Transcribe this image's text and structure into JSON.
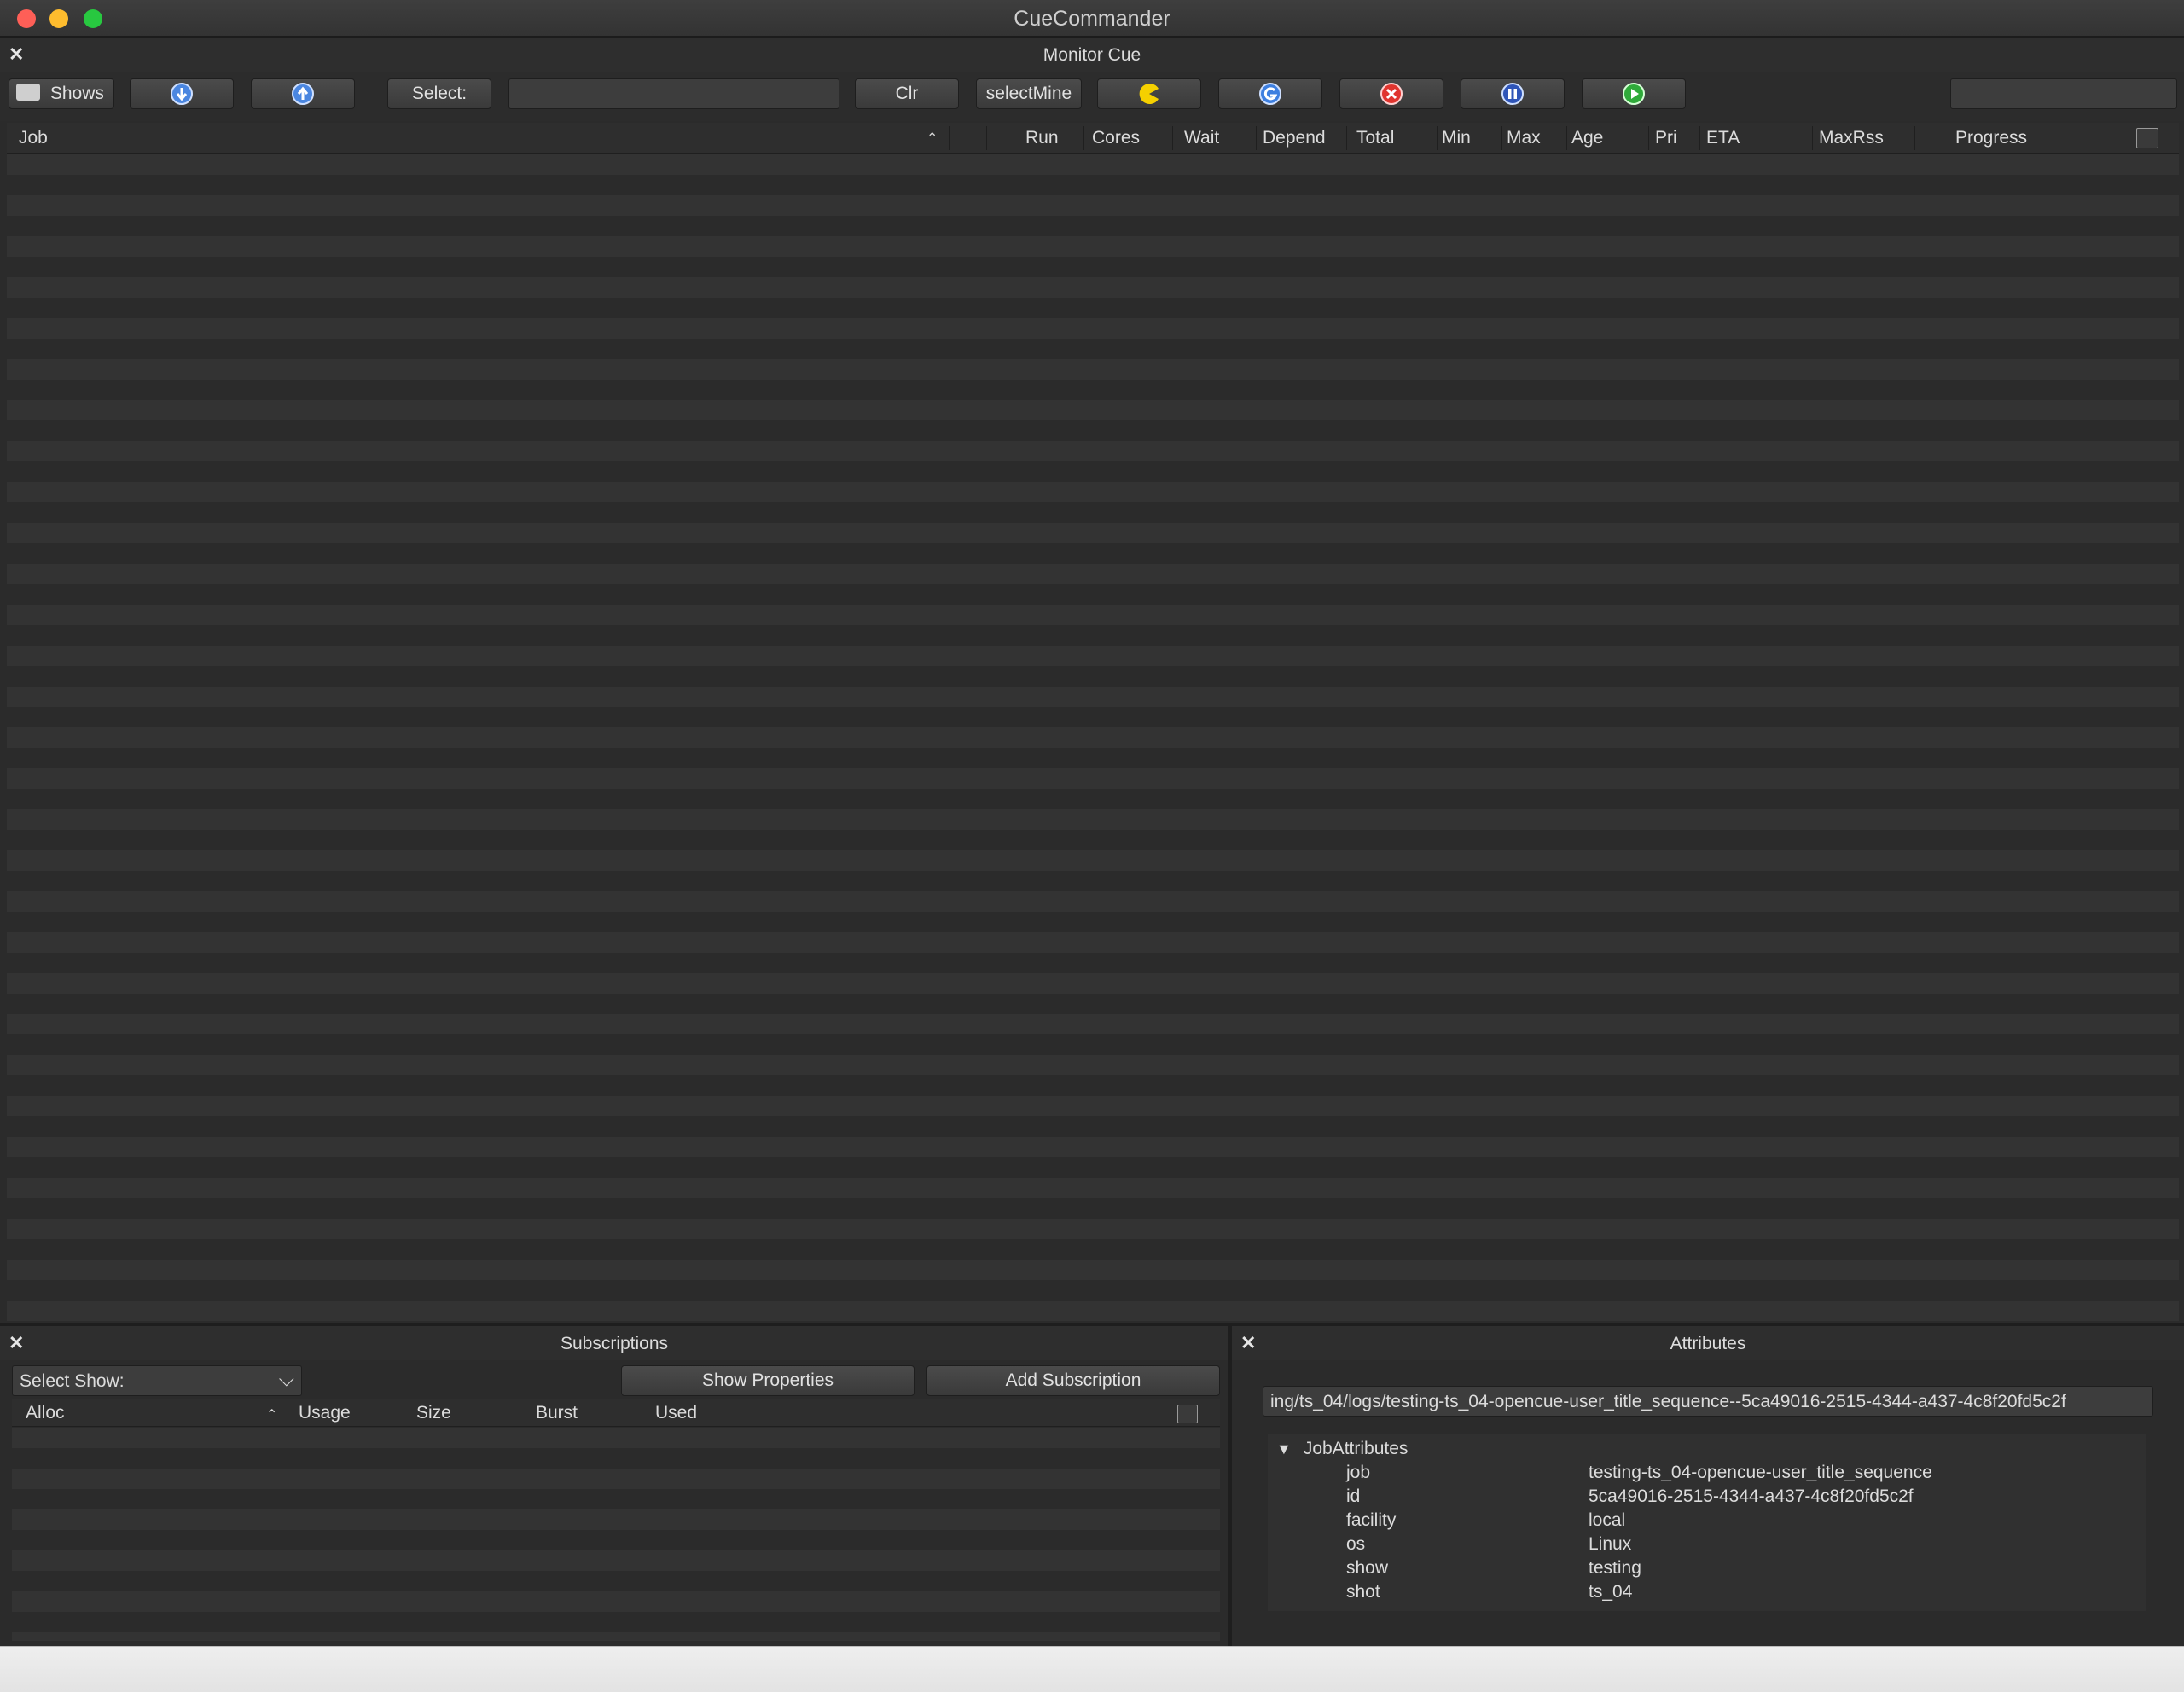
{
  "window": {
    "title": "CueCommander"
  },
  "monitor_cue": {
    "title": "Monitor Cue",
    "toolbar": {
      "shows_label": "Shows",
      "select_label": "Select:",
      "clr_label": "Clr",
      "selectmine_label": "selectMine"
    },
    "columns": [
      "Job",
      "Run",
      "Cores",
      "Wait",
      "Depend",
      "Total",
      "Min",
      "Max",
      "Age",
      "Pri",
      "ETA",
      "MaxRss",
      "Progress"
    ]
  },
  "subscriptions": {
    "title": "Subscriptions",
    "select_show": "Select Show:",
    "show_properties": "Show Properties",
    "add_subscription": "Add Subscription",
    "columns": [
      "Alloc",
      "Usage",
      "Size",
      "Burst",
      "Used"
    ]
  },
  "attributes": {
    "title": "Attributes",
    "path": "ing/ts_04/logs/testing-ts_04-opencue-user_title_sequence--5ca49016-2515-4344-a437-4c8f20fd5c2f",
    "group": "JobAttributes",
    "items": [
      {
        "key": "job",
        "value": "testing-ts_04-opencue-user_title_sequence"
      },
      {
        "key": "id",
        "value": "5ca49016-2515-4344-a437-4c8f20fd5c2f"
      },
      {
        "key": "facility",
        "value": "local"
      },
      {
        "key": "os",
        "value": "Linux"
      },
      {
        "key": "show",
        "value": "testing"
      },
      {
        "key": "shot",
        "value": "ts_04"
      }
    ]
  },
  "colors": {
    "eat_icon": "#f5d000",
    "retry_icon": "#3d7fe0",
    "kill_icon": "#e0342e",
    "pause_icon": "#2f55b8",
    "unpause_icon": "#2faa3a"
  }
}
